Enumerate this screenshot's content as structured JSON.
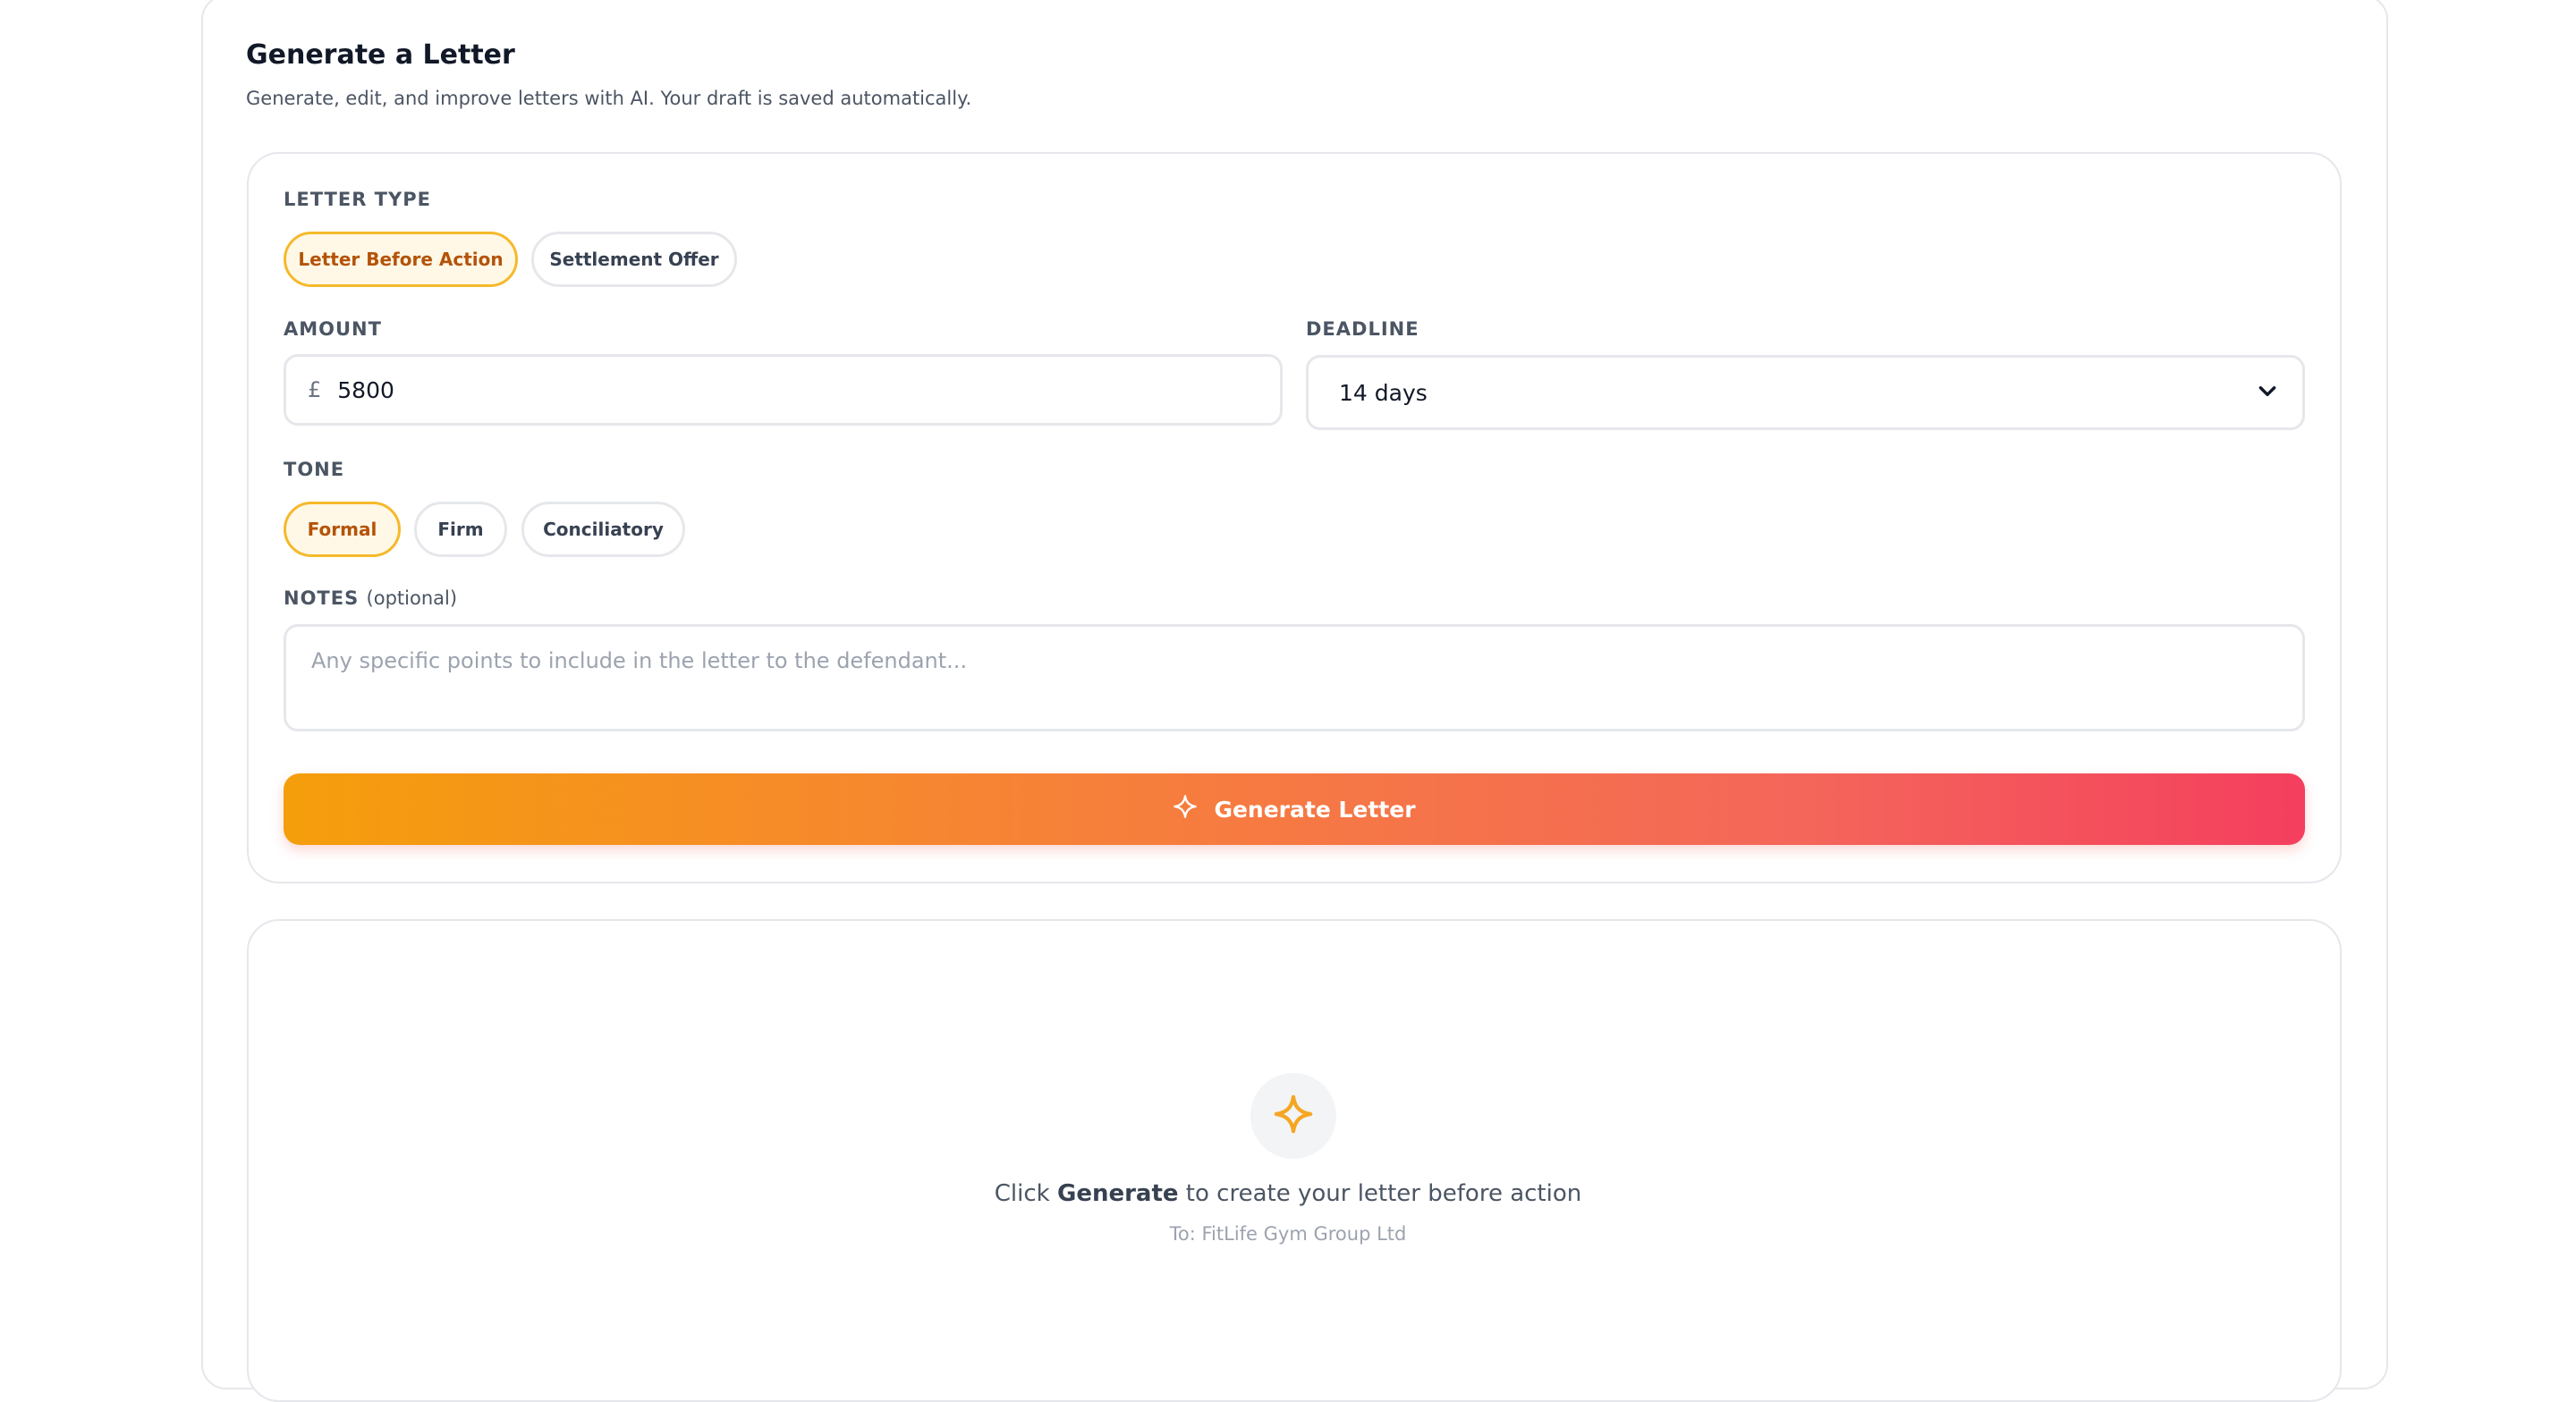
{
  "header": {
    "title": "Generate a Letter",
    "subtitle": "Generate, edit, and improve letters with AI. Your draft is saved automatically."
  },
  "form": {
    "letter_type": {
      "label": "LETTER TYPE",
      "options": [
        "Letter Before Action",
        "Settlement Offer"
      ],
      "selected": "Letter Before Action"
    },
    "amount": {
      "label": "AMOUNT",
      "currency": "£",
      "value": "5800"
    },
    "deadline": {
      "label": "DEADLINE",
      "value": "14 days"
    },
    "tone": {
      "label": "TONE",
      "options": [
        "Formal",
        "Firm",
        "Conciliatory"
      ],
      "selected": "Formal"
    },
    "notes": {
      "label": "NOTES",
      "optional": "(optional)",
      "placeholder": "Any specific points to include in the letter to the defendant...",
      "value": ""
    },
    "generate_label": "Generate Letter"
  },
  "preview": {
    "prefix": "Click ",
    "bold": "Generate",
    "suffix": " to create your letter before action",
    "recipient": "To: FitLife Gym Group Ltd"
  },
  "colors": {
    "accent": "#f5b92a",
    "gradient_start": "#f59e0b",
    "gradient_end": "#f43f5e"
  },
  "icons": {
    "generate": "sparkle-icon",
    "dropdown": "chevron-down-icon",
    "empty_state": "sparkle-icon"
  }
}
